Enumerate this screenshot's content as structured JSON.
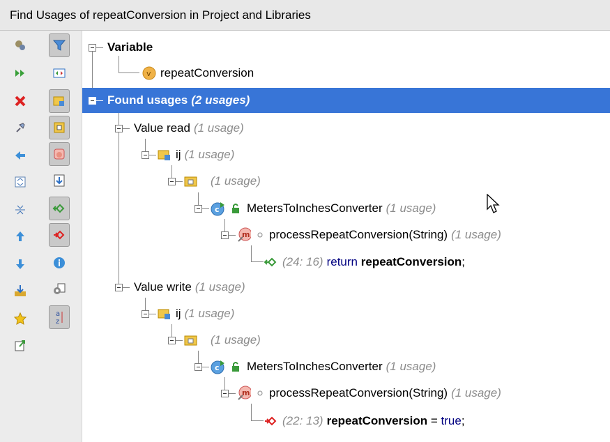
{
  "title": "Find  Usages of repeatConversion in Project and Libraries",
  "toolbar": {
    "left": [
      "rerun-icon",
      "expand-all-next-icon",
      "close-icon",
      "pin-icon",
      "previous-occurrence-icon",
      "expand-all-icon",
      "collapse-all-icon",
      "move-up-icon",
      "move-down-icon",
      "export-icon",
      "favorites-icon",
      "jump-to-source-icon"
    ],
    "right": [
      "filter-icon",
      "preview-icon",
      "group-by-module-icon",
      "group-by-package-icon",
      "group-by-method-icon",
      "autoscroll-icon",
      "show-read-access-icon",
      "show-write-access-icon",
      "info-icon",
      "settings-icon",
      "sort-alpha-icon"
    ]
  },
  "tree": {
    "variable_label": "Variable",
    "variable_name": "repeatConversion",
    "found_label": "Found usages",
    "found_count": "(2 usages)",
    "read": {
      "label": "Value read",
      "count": "(1 usage)",
      "module": "ij",
      "module_count": "(1 usage)",
      "pkg_count": "(1 usage)",
      "cls": "MetersToInchesConverter",
      "cls_count": "(1 usage)",
      "method": "processRepeatConversion(String)",
      "method_count": "(1 usage)",
      "loc": "(24: 16)",
      "code_kw": "return",
      "code_var": "repeatConversion",
      "code_end": ";"
    },
    "write": {
      "label": "Value write",
      "count": "(1 usage)",
      "module": "ij",
      "module_count": "(1 usage)",
      "pkg_count": "(1 usage)",
      "cls": "MetersToInchesConverter",
      "cls_count": "(1 usage)",
      "method": "processRepeatConversion(String)",
      "method_count": "(1 usage)",
      "loc": "(22: 13)",
      "code_var": "repeatConversion",
      "code_op": " = ",
      "code_kw": "true",
      "code_end": ";"
    }
  },
  "colors": {
    "selection": "#3875d7",
    "usage_count": "#8c8c8c",
    "keyword": "#000080"
  }
}
